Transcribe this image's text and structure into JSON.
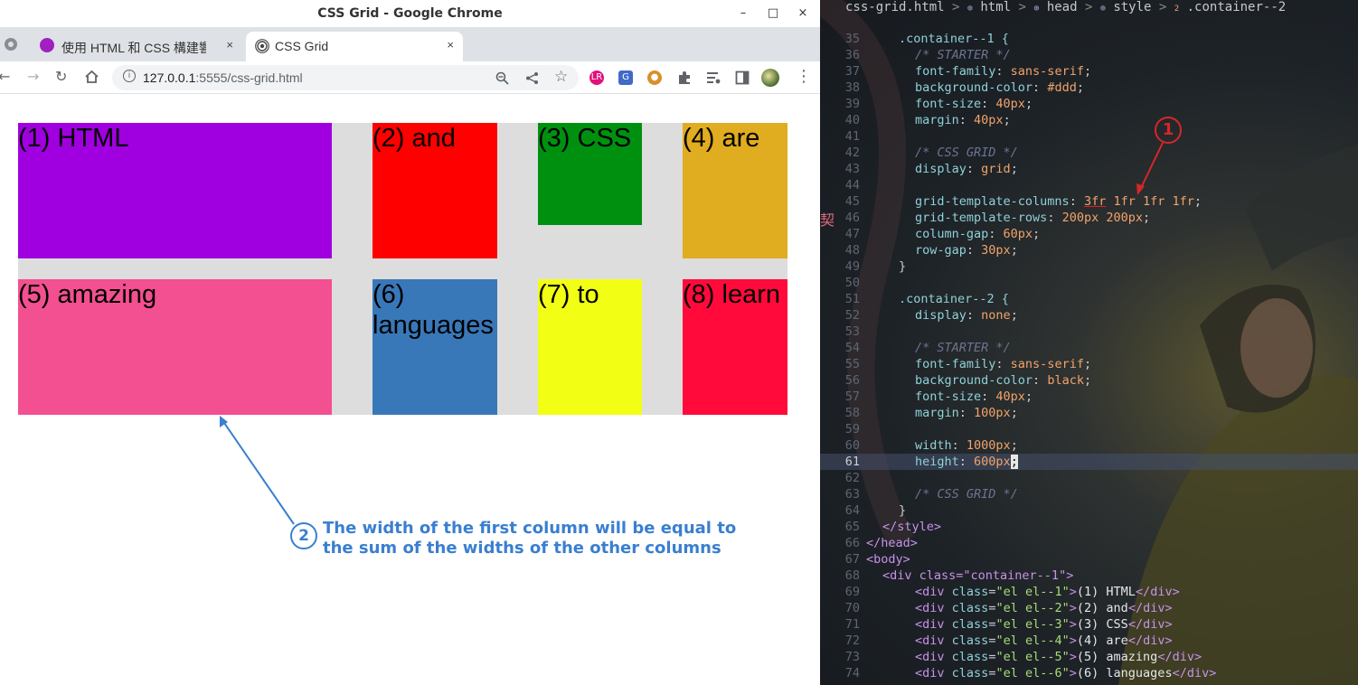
{
  "window": {
    "title": "CSS Grid - Google Chrome",
    "controls": {
      "minimize": "–",
      "maximize": "□",
      "close": "×"
    }
  },
  "tabs": [
    {
      "label": "使用 HTML 和 CSS 構建響應",
      "icon": "info-favicon-icon",
      "close": "×"
    },
    {
      "label": "CSS Grid",
      "icon": "broadcast-favicon-icon",
      "close": "×"
    }
  ],
  "toolbar": {
    "url_host": "127.0.0.1",
    "url_rest": ":5555/css-grid.html",
    "new_tab": "+"
  },
  "grid": {
    "background": "#dddddd",
    "items": [
      {
        "label": "(1) HTML",
        "color": "#a000e0"
      },
      {
        "label": "(2) and",
        "color": "#ff0000"
      },
      {
        "label": "(3) CSS",
        "color": "#009010"
      },
      {
        "label": "(4) are",
        "color": "#e0ac20"
      },
      {
        "label": "(5) amazing",
        "color": "#f25090"
      },
      {
        "label": "(6) languages",
        "color": "#3878b8"
      },
      {
        "label": "(7) to",
        "color": "#f2ff14"
      },
      {
        "label": "(8) learn",
        "color": "#ff0a3a"
      }
    ]
  },
  "annotations": {
    "note2_number": "2",
    "note2_line1": "The width of the first column will be equal to",
    "note2_line2": "the sum of the widths of the other columns",
    "note1_number": "1",
    "note_color": "#3a7fd0",
    "badge_color": "#d7262a"
  },
  "editor": {
    "breadcrumb": {
      "file": "css-grid.html",
      "html": "html",
      "head": "head",
      "style": "style",
      "selector_index": "2",
      "selector": ".container--2"
    },
    "side_glyph": "契",
    "lines": [
      {
        "n": "35",
        "text": ".container--1 {"
      },
      {
        "n": "36",
        "text": "/* STARTER */"
      },
      {
        "n": "37",
        "prop": "font-family",
        "val": "sans-serif"
      },
      {
        "n": "38",
        "prop": "background-color",
        "val": "#ddd"
      },
      {
        "n": "39",
        "prop": "font-size",
        "val": "40px"
      },
      {
        "n": "40",
        "prop": "margin",
        "val": "40px"
      },
      {
        "n": "41",
        "text": ""
      },
      {
        "n": "42",
        "text": "/* CSS GRID */"
      },
      {
        "n": "43",
        "prop": "display",
        "val": "grid"
      },
      {
        "n": "44",
        "text": ""
      },
      {
        "n": "45",
        "prop": "grid-template-columns",
        "val_u": "3fr",
        "val": " 1fr 1fr 1fr"
      },
      {
        "n": "46",
        "prop": "grid-template-rows",
        "val": "200px 200px"
      },
      {
        "n": "47",
        "prop": "column-gap",
        "val": "60px"
      },
      {
        "n": "48",
        "prop": "row-gap",
        "val": "30px"
      },
      {
        "n": "49",
        "text": "}"
      },
      {
        "n": "50",
        "text": ""
      },
      {
        "n": "51",
        "text": ".container--2 {"
      },
      {
        "n": "52",
        "prop": "display",
        "val": "none"
      },
      {
        "n": "53",
        "text": ""
      },
      {
        "n": "54",
        "text": "/* STARTER */"
      },
      {
        "n": "55",
        "prop": "font-family",
        "val": "sans-serif"
      },
      {
        "n": "56",
        "prop": "background-color",
        "val": "black"
      },
      {
        "n": "57",
        "prop": "font-size",
        "val": "40px"
      },
      {
        "n": "58",
        "prop": "margin",
        "val": "100px"
      },
      {
        "n": "59",
        "text": ""
      },
      {
        "n": "60",
        "prop": "width",
        "val": "1000px"
      },
      {
        "n": "61",
        "prop": "height",
        "val": "600px"
      },
      {
        "n": "62",
        "text": ""
      },
      {
        "n": "63",
        "text": "/* CSS GRID */"
      },
      {
        "n": "64",
        "text": "}"
      },
      {
        "n": "65",
        "text": "</style>"
      },
      {
        "n": "66",
        "text": "</head>"
      },
      {
        "n": "67",
        "text": "<body>"
      },
      {
        "n": "68",
        "text": "<div class=\"container--1\">"
      },
      {
        "n": "69",
        "cls": "el el--1",
        "inner": "(1) HTML"
      },
      {
        "n": "70",
        "cls": "el el--2",
        "inner": "(2) and"
      },
      {
        "n": "71",
        "cls": "el el--3",
        "inner": "(3) CSS"
      },
      {
        "n": "72",
        "cls": "el el--4",
        "inner": "(4) are"
      },
      {
        "n": "73",
        "cls": "el el--5",
        "inner": "(5) amazing"
      },
      {
        "n": "74",
        "cls": "el el--6",
        "inner": "(6) languages"
      }
    ]
  }
}
